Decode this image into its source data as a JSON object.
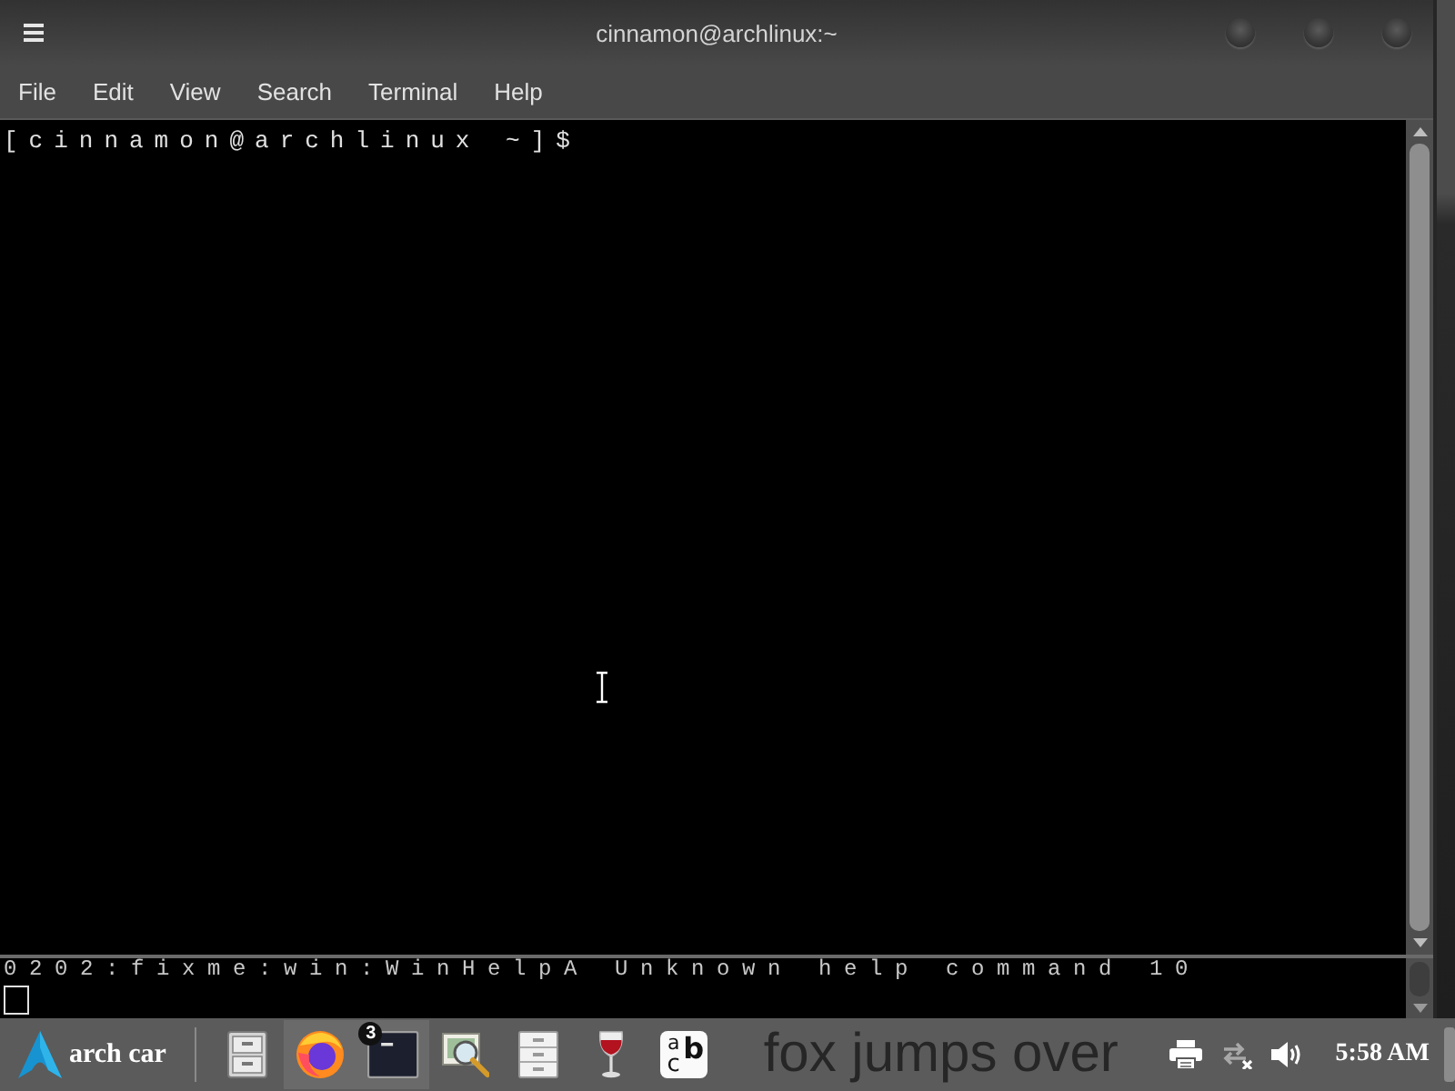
{
  "window": {
    "title": "cinnamon@archlinux:~"
  },
  "menu_bar": [
    "File",
    "Edit",
    "View",
    "Search",
    "Terminal",
    "Help"
  ],
  "terminal": {
    "lines": [
      "[cinnamon@archlinux ~]$"
    ]
  },
  "background_terminal": {
    "lines": [
      "0202:fixme:win:WinHelpA Unknown help command 10"
    ]
  },
  "desktop_text": "fox jumps over",
  "taskbar": {
    "menu_label": "arch car",
    "launchers": [
      {
        "kind": "cabinet",
        "running": false
      },
      {
        "kind": "browser",
        "running": true
      },
      {
        "kind": "terminal",
        "running": true,
        "badge": "3"
      },
      {
        "kind": "image-viewer",
        "running": false
      },
      {
        "kind": "file-cabinet",
        "running": false
      },
      {
        "kind": "wine",
        "running": false
      },
      {
        "kind": "font",
        "running": false,
        "letters": [
          "a",
          "b",
          "c"
        ]
      }
    ],
    "tray": [
      {
        "kind": "printer"
      },
      {
        "kind": "network"
      },
      {
        "kind": "volume"
      }
    ],
    "clock": "5:58 AM"
  }
}
